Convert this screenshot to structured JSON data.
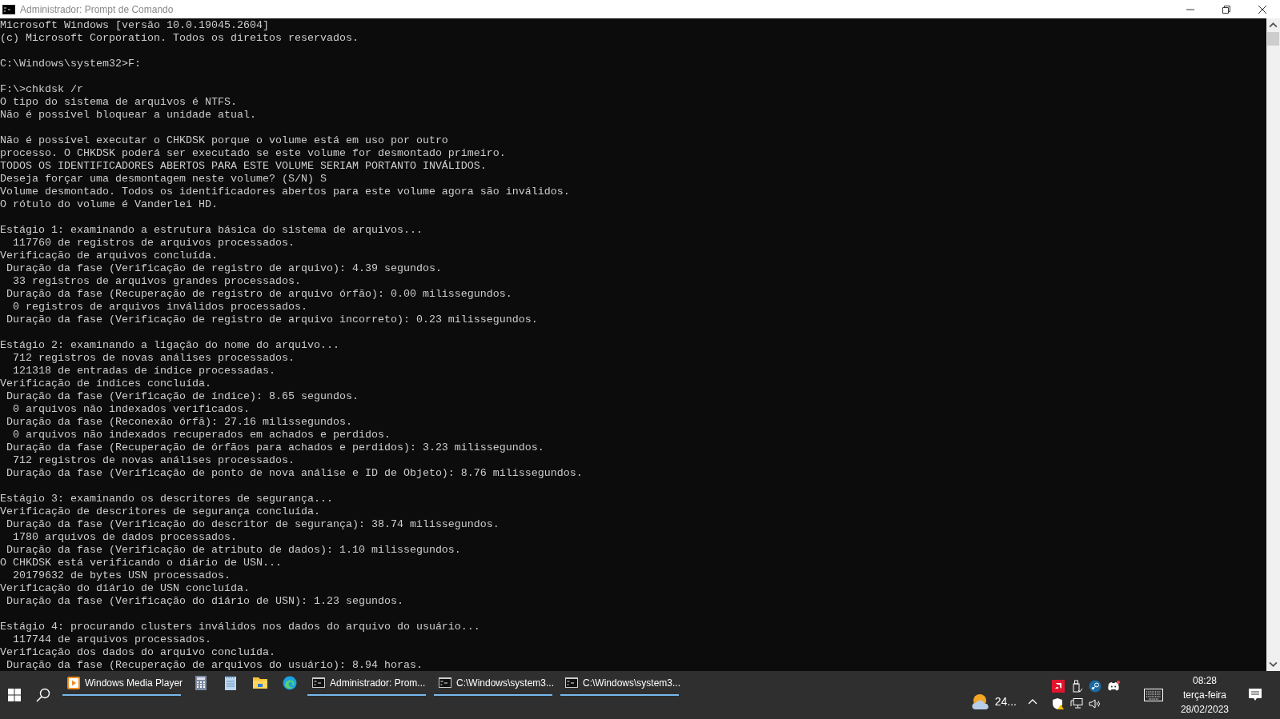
{
  "window": {
    "title": "Administrador: Prompt de Comando"
  },
  "console": {
    "blocks": [
      [
        "Microsoft Windows [versão 10.0.19045.2604]",
        "(c) Microsoft Corporation. Todos os direitos reservados."
      ],
      [
        "C:\\Windows\\system32>F:"
      ],
      [
        "F:\\>chkdsk /r",
        "O tipo do sistema de arquivos é NTFS.",
        "Não é possível bloquear a unidade atual."
      ],
      [
        "Não é possível executar o CHKDSK porque o volume está em uso por outro",
        "processo. O CHKDSK poderá ser executado se este volume for desmontado primeiro.",
        "TODOS OS IDENTIFICADORES ABERTOS PARA ESTE VOLUME SERIAM PORTANTO INVÁLIDOS.",
        "Deseja forçar uma desmontagem neste volume? (S/N) S",
        "Volume desmontado. Todos os identificadores abertos para este volume agora são inválidos.",
        "O rótulo do volume é Vanderlei HD."
      ],
      [
        "Estágio 1: examinando a estrutura básica do sistema de arquivos...",
        "  117760 de registros de arquivos processados.",
        "Verificação de arquivos concluída.",
        " Duração da fase (Verificação de registro de arquivo): 4.39 segundos.",
        "  33 registros de arquivos grandes processados.",
        " Duração da fase (Recuperação de registro de arquivo órfão): 0.00 milissegundos.",
        "  0 registros de arquivos inválidos processados.",
        " Duração da fase (Verificação de registro de arquivo incorreto): 0.23 milissegundos."
      ],
      [
        "Estágio 2: examinando a ligação do nome do arquivo...",
        "  712 registros de novas análises processados.",
        "  121318 de entradas de índice processadas.",
        "Verificação de índices concluída.",
        " Duração da fase (Verificação de índice): 8.65 segundos.",
        "  0 arquivos não indexados verificados.",
        " Duração da fase (Reconexão órfã): 27.16 milissegundos.",
        "  0 arquivos não indexados recuperados em achados e perdidos.",
        " Duração da fase (Recuperação de órfãos para achados e perdidos): 3.23 milissegundos.",
        "  712 registros de novas análises processados.",
        " Duração da fase (Verificação de ponto de nova análise e ID de Objeto): 8.76 milissegundos."
      ],
      [
        "Estágio 3: examinando os descritores de segurança...",
        "Verificação de descritores de segurança concluída.",
        " Duração da fase (Verificação do descritor de segurança): 38.74 milissegundos.",
        "  1780 arquivos de dados processados.",
        " Duração da fase (Verificação de atributo de dados): 1.10 milissegundos.",
        "O CHKDSK está verificando o diário de USN...",
        "  20179632 de bytes USN processados.",
        "Verificação do diário de USN concluída.",
        " Duração da fase (Verificação do diário de USN): 1.23 segundos."
      ],
      [
        "Estágio 4: procurando clusters inválidos nos dados do arquivo do usuário...",
        "  117744 de arquivos processados.",
        "Verificação dos dados do arquivo concluída.",
        " Duração da fase (Recuperação de arquivos do usuário): 8.94 horas."
      ]
    ]
  },
  "taskbar": {
    "items": [
      {
        "kind": "app",
        "label": "Windows Media Player",
        "running": true
      },
      {
        "kind": "pin",
        "running": false
      },
      {
        "kind": "pin",
        "running": false
      },
      {
        "kind": "pin",
        "running": false
      },
      {
        "kind": "pin",
        "running": false
      },
      {
        "kind": "app",
        "label": "Administrador: Prom...",
        "running": true
      },
      {
        "kind": "app",
        "label": "C:\\Windows\\system3...",
        "running": true
      },
      {
        "kind": "app",
        "label": "C:\\Windows\\system3...",
        "running": true
      }
    ],
    "weather": "24...",
    "clock": {
      "time": "08:28",
      "day": "terça-feira",
      "date": "28/02/2023"
    }
  }
}
